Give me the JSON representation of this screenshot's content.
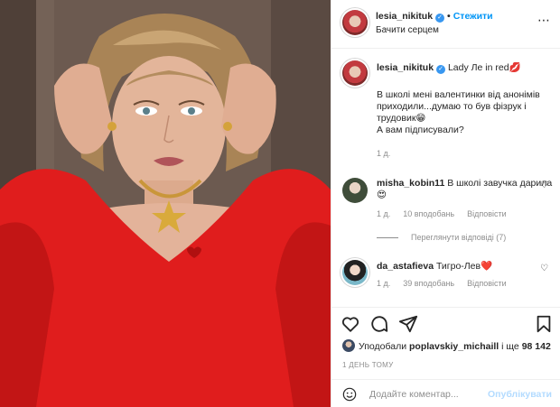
{
  "header": {
    "username": "lesia_nikituk",
    "follow_label": "Стежити",
    "subtitle": "Бачити серцем",
    "more_label": "⋯"
  },
  "caption": {
    "username": "lesia_nikituk",
    "text_line1": "Lady Ле in red💋",
    "body": "В школі мені валентинки від анонімів приходили...думаю то був фізрук і трудовик😁",
    "body2": "А вам підписували?",
    "time": "1 д."
  },
  "comments": [
    {
      "username": "misha_kobin11",
      "text": "В школі завучка дарила😍",
      "time": "1 д.",
      "likes": "10 вподобань",
      "reply": "Відповісти"
    },
    {
      "username": "da_astafieva",
      "text": "Тигро-Лев❤️",
      "time": "1 д.",
      "likes": "39 вподобань",
      "reply": "Відповісти"
    }
  ],
  "view_replies": "Переглянути відповіді (7)",
  "likes_line": {
    "prefix": "Уподобали",
    "user": "poplavskiy_michaill",
    "and": "і ще",
    "count": "98 142"
  },
  "time_ago": "1 ДЕНЬ ТОМУ",
  "add_comment": {
    "placeholder": "Додайте коментар...",
    "publish": "Опублікувати"
  },
  "colors": {
    "accent": "#0095f6",
    "text": "#262626",
    "muted": "#8e8e8e",
    "dress": "#e01d1d"
  },
  "icons": [
    "heart-icon",
    "comment-icon",
    "share-icon",
    "bookmark-icon",
    "emoji-icon",
    "more-icon",
    "verified-icon"
  ]
}
